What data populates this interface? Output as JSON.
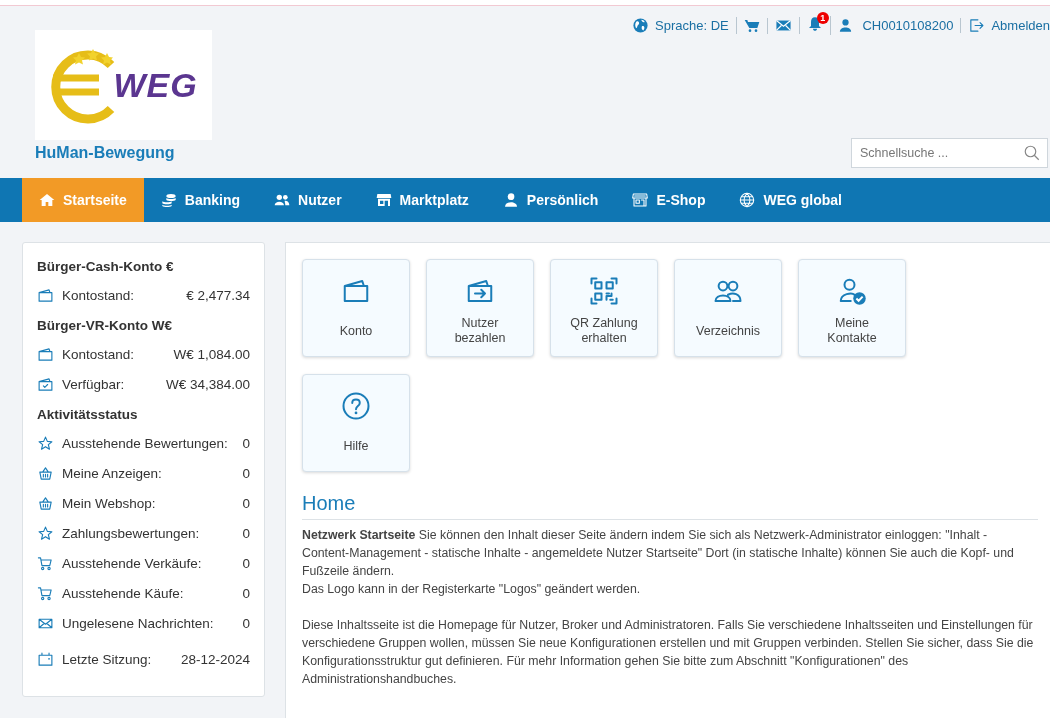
{
  "top_bar": {
    "language": "Sprache: DE",
    "notification_count": "1",
    "user_id": "CH0010108200",
    "logout": "Abmelden"
  },
  "logo": {
    "text": "WEG",
    "site_name": "HuMan-Bewegung"
  },
  "search": {
    "placeholder": "Schnellsuche ..."
  },
  "nav": [
    {
      "label": "Startseite",
      "kind": "home",
      "selected": true
    },
    {
      "label": "Banking",
      "kind": "coins",
      "selected": false
    },
    {
      "label": "Nutzer",
      "kind": "users",
      "selected": false
    },
    {
      "label": "Marktplatz",
      "kind": "store",
      "selected": false
    },
    {
      "label": "Persönlich",
      "kind": "user",
      "selected": false
    },
    {
      "label": "E-Shop",
      "kind": "shop",
      "selected": false
    },
    {
      "label": "WEG global",
      "kind": "globe",
      "selected": false
    }
  ],
  "sidebar": [
    {
      "title": "Bürger-Cash-Konto €",
      "rows": [
        {
          "kind": "wallet",
          "label": "Kontostand:",
          "value": "€ 2,477.34"
        }
      ]
    },
    {
      "title": "Bürger-VR-Konto W€",
      "rows": [
        {
          "kind": "wallet",
          "label": "Kontostand:",
          "value": "W€ 1,084.00"
        },
        {
          "kind": "available",
          "label": "Verfügbar:",
          "value": "W€ 34,384.00"
        }
      ]
    },
    {
      "title": "Aktivitätsstatus",
      "rows": [
        {
          "kind": "rating",
          "label": "Ausstehende Bewertungen:",
          "value": "0"
        },
        {
          "kind": "ads",
          "label": "Meine Anzeigen:",
          "value": "0"
        },
        {
          "kind": "ads",
          "label": "Mein Webshop:",
          "value": "0"
        },
        {
          "kind": "rating",
          "label": "Zahlungsbewertungen:",
          "value": "0"
        },
        {
          "kind": "cart",
          "label": "Ausstehende Verkäufe:",
          "value": "0"
        },
        {
          "kind": "cart",
          "label": "Ausstehende Käufe:",
          "value": "0"
        },
        {
          "kind": "mail",
          "label": "Ungelesene Nachrichten:",
          "value": "0"
        }
      ]
    },
    {
      "rows": [
        {
          "kind": "calendar",
          "label": "Letzte Sitzung:",
          "value": "28-12-2024"
        }
      ]
    }
  ],
  "tiles": [
    {
      "kind": "wallet",
      "label": "Konto"
    },
    {
      "kind": "transfer",
      "label": "Nutzer bezahlen"
    },
    {
      "kind": "qr",
      "label": "QR Zahlung erhalten"
    },
    {
      "kind": "people",
      "label": "Verzeichnis"
    },
    {
      "kind": "contact",
      "label": "Meine Kontakte"
    },
    {
      "kind": "help",
      "label": "Hilfe"
    }
  ],
  "content": {
    "heading": "Home",
    "paragraphs": [
      {
        "lines": [
          "**Netzwerk Startseite** Sie können den Inhalt dieser Seite ändern indem Sie sich als Netzwerk-Administrator einloggen: \"Inhalt - Content-Management - statische Inhalte - angemeldete Nutzer Startseite\" Dort (in statische Inhalte) können Sie auch die Kopf- und Fußzeile ändern.",
          "Das Logo kann in der Registerkarte \"Logos\" geändert werden."
        ]
      },
      {
        "lines": [
          "Diese Inhaltsseite ist die Homepage für Nutzer, Broker und Administratoren. Falls Sie verschiedene Inhaltsseiten und Einstellungen für verschiedene Gruppen wollen, müssen Sie neue Konfigurationen erstellen und mit Gruppen verbinden. Stellen Sie sicher, dass Sie die Konfigurationsstruktur gut definieren. Für mehr Information gehen Sie bitte zum Abschnitt \"Konfigurationen\" des Administrationshandbuches."
        ]
      }
    ]
  }
}
